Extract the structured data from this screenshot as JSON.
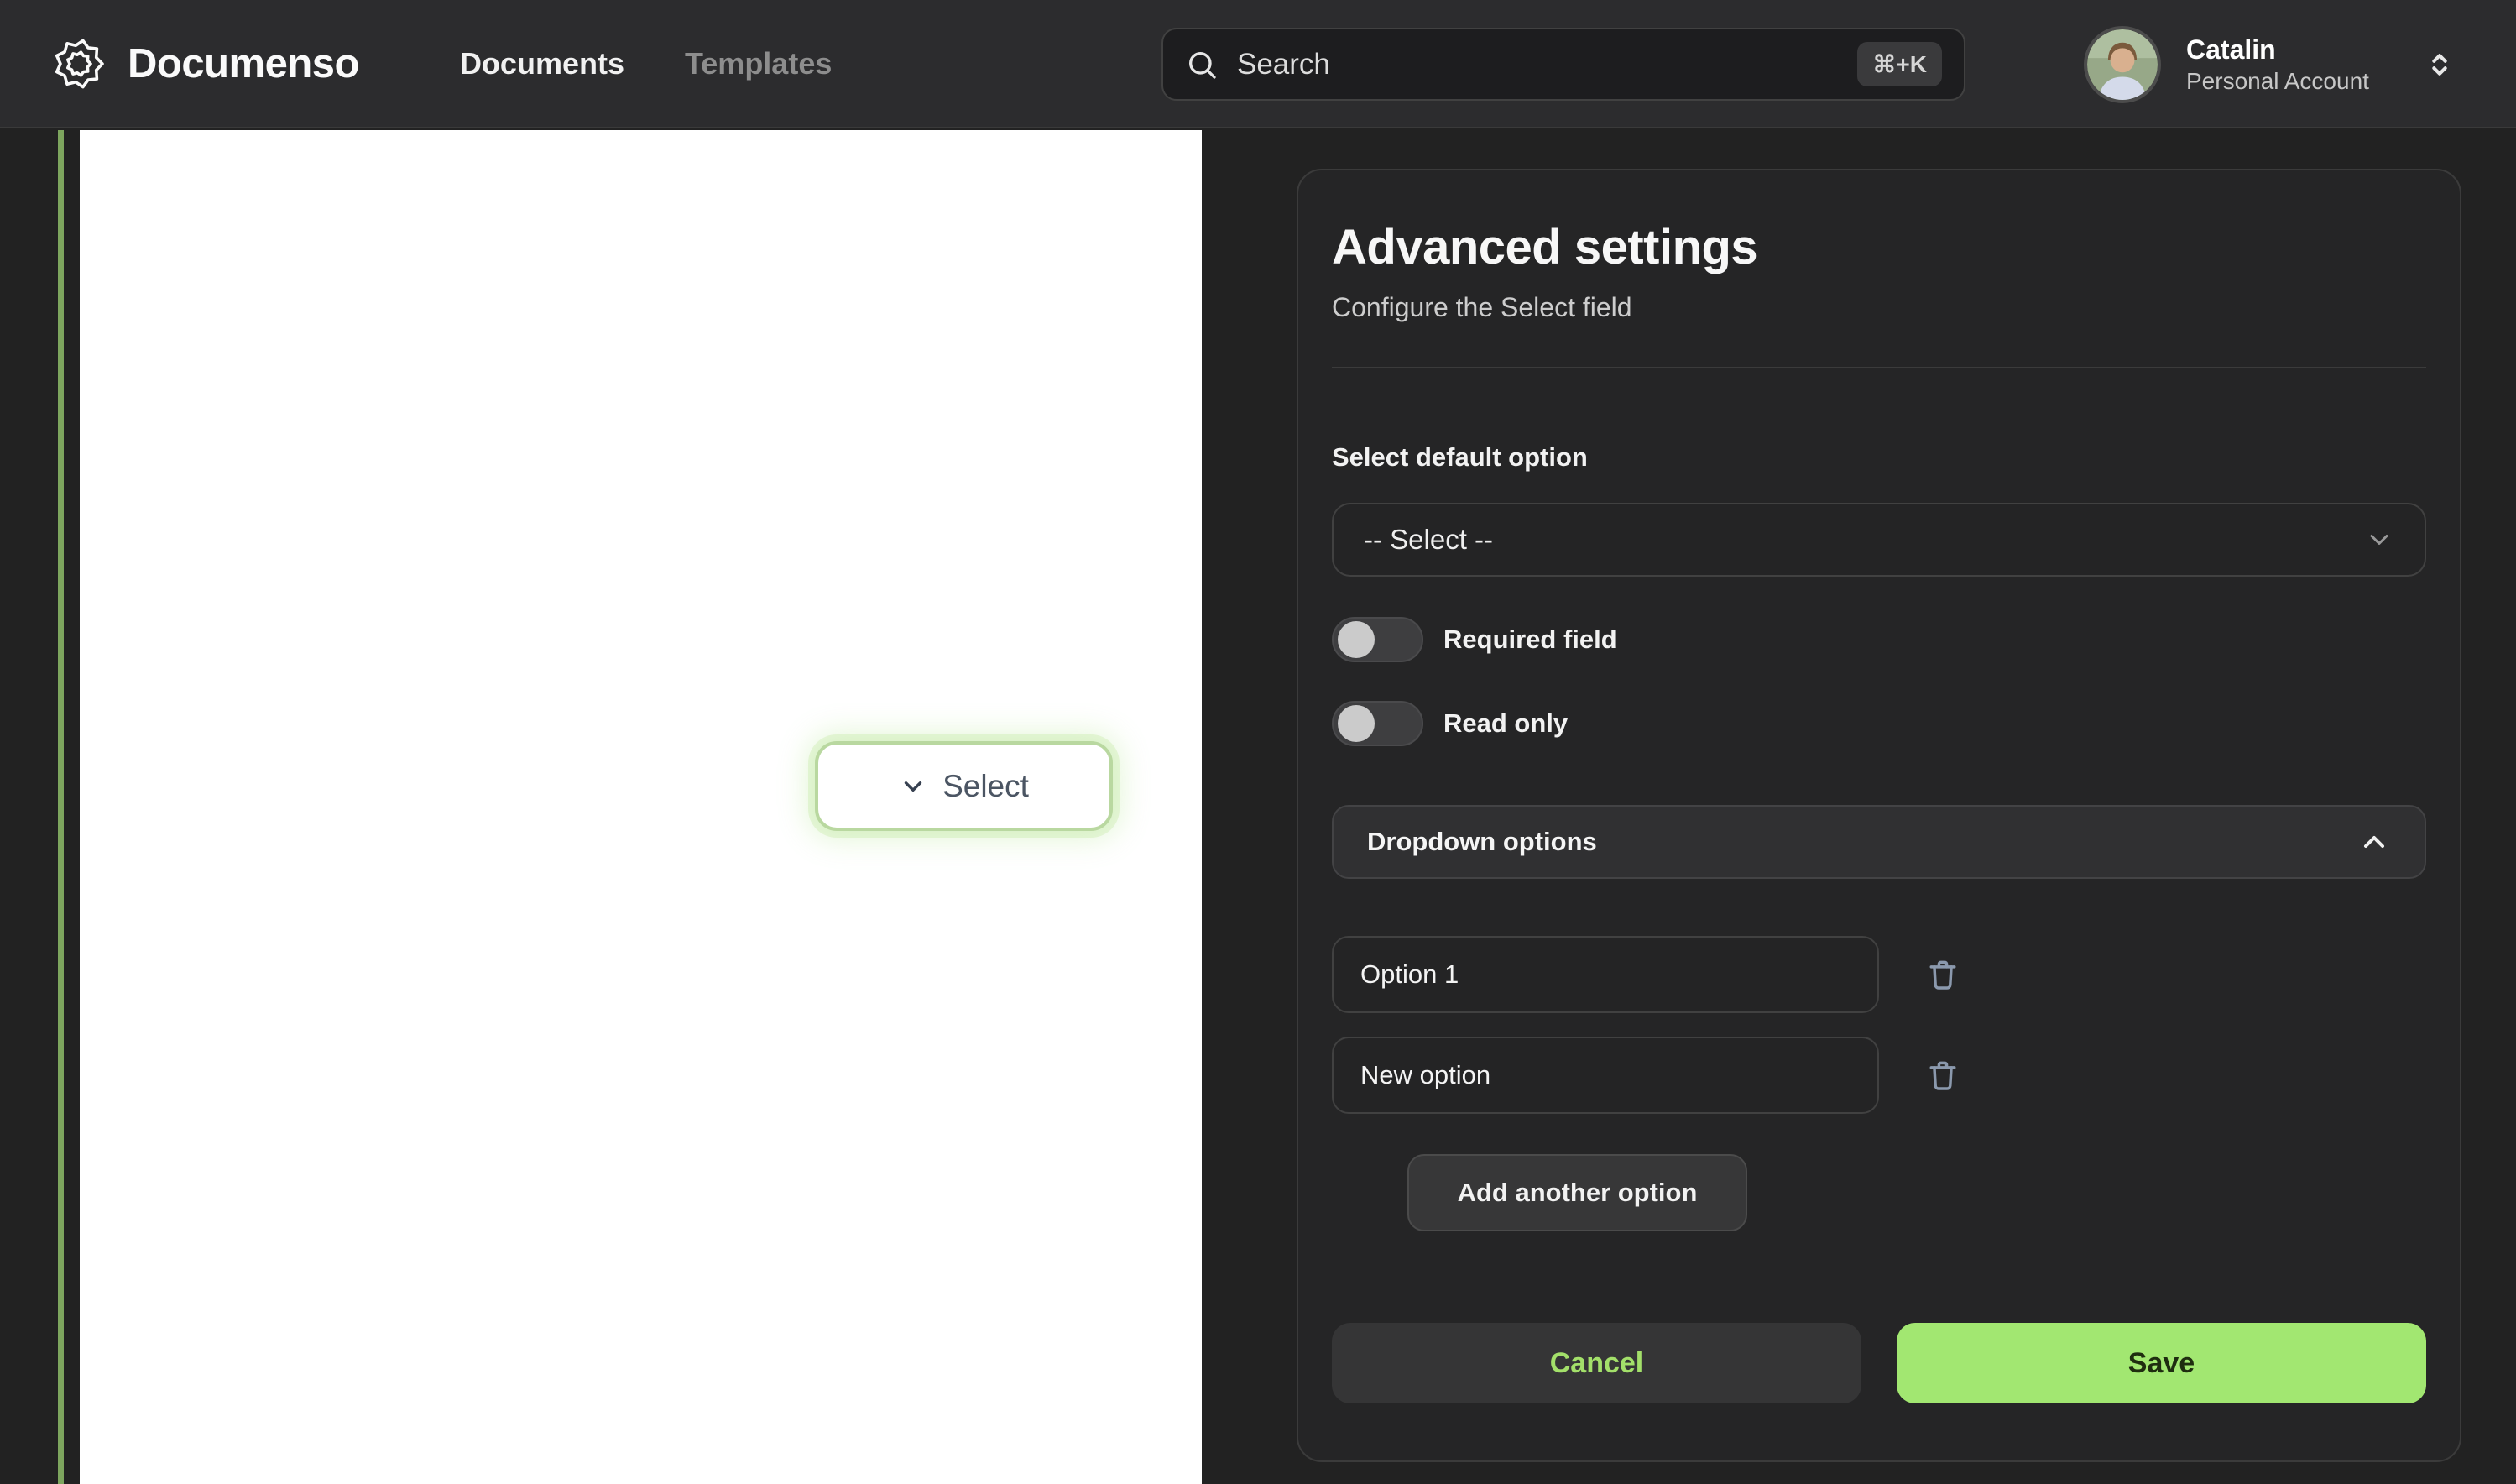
{
  "header": {
    "logo": "Documenso",
    "nav": {
      "documents": "Documents",
      "templates": "Templates"
    },
    "search": {
      "placeholder": "Search",
      "shortcut": "⌘+K"
    },
    "user": {
      "name": "Catalin",
      "account": "Personal Account"
    }
  },
  "document": {
    "select_field": {
      "label": "Select"
    }
  },
  "panel": {
    "title": "Advanced settings",
    "subtitle": "Configure the Select field",
    "default_option": {
      "label": "Select default option",
      "value": "-- Select --"
    },
    "toggles": [
      {
        "label": "Required field",
        "on": false
      },
      {
        "label": "Read only",
        "on": false
      }
    ],
    "dropdown_section": {
      "label": "Dropdown options",
      "expanded": true
    },
    "options": [
      {
        "value": "Option 1"
      },
      {
        "value": "New option"
      }
    ],
    "add_button": "Add another option",
    "cancel_button": "Cancel",
    "save_button": "Save"
  },
  "colors": {
    "accent_green": "#a2e771",
    "field_border_green": "#b9d8a0",
    "header_bg": "#2c2c2e",
    "panel_bg": "#252526"
  }
}
